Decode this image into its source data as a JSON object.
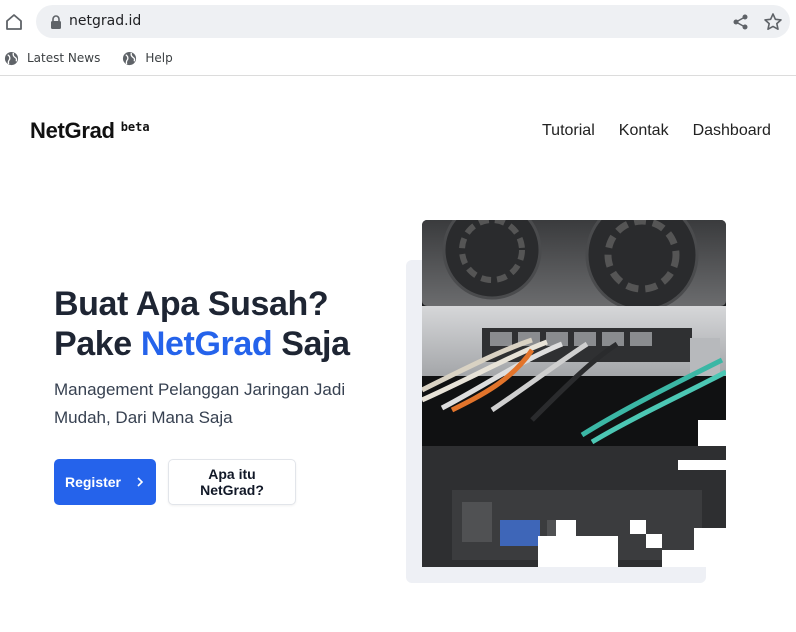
{
  "browser": {
    "url": "netgrad.id",
    "bookmarks": [
      {
        "label": "Latest News",
        "icon": "globe-icon"
      },
      {
        "label": "Help",
        "icon": "globe-icon"
      }
    ]
  },
  "header": {
    "brand": "NetGrad",
    "badge": "beta",
    "nav": [
      "Tutorial",
      "Kontak",
      "Dashboard"
    ]
  },
  "hero": {
    "title_line1": "Buat Apa Susah?",
    "title_line2_pre": "Pake ",
    "title_line2_accent": "NetGrad",
    "title_line2_post": " Saja",
    "subtitle": "Management Pelanggan Jaringan Jadi Mudah, Dari Mana Saja",
    "primary_button": "Register",
    "secondary_button": "Apa itu NetGrad?",
    "image_icon": "network-switch-photo"
  },
  "colors": {
    "accent": "#2563eb",
    "heading": "#1e2533"
  }
}
